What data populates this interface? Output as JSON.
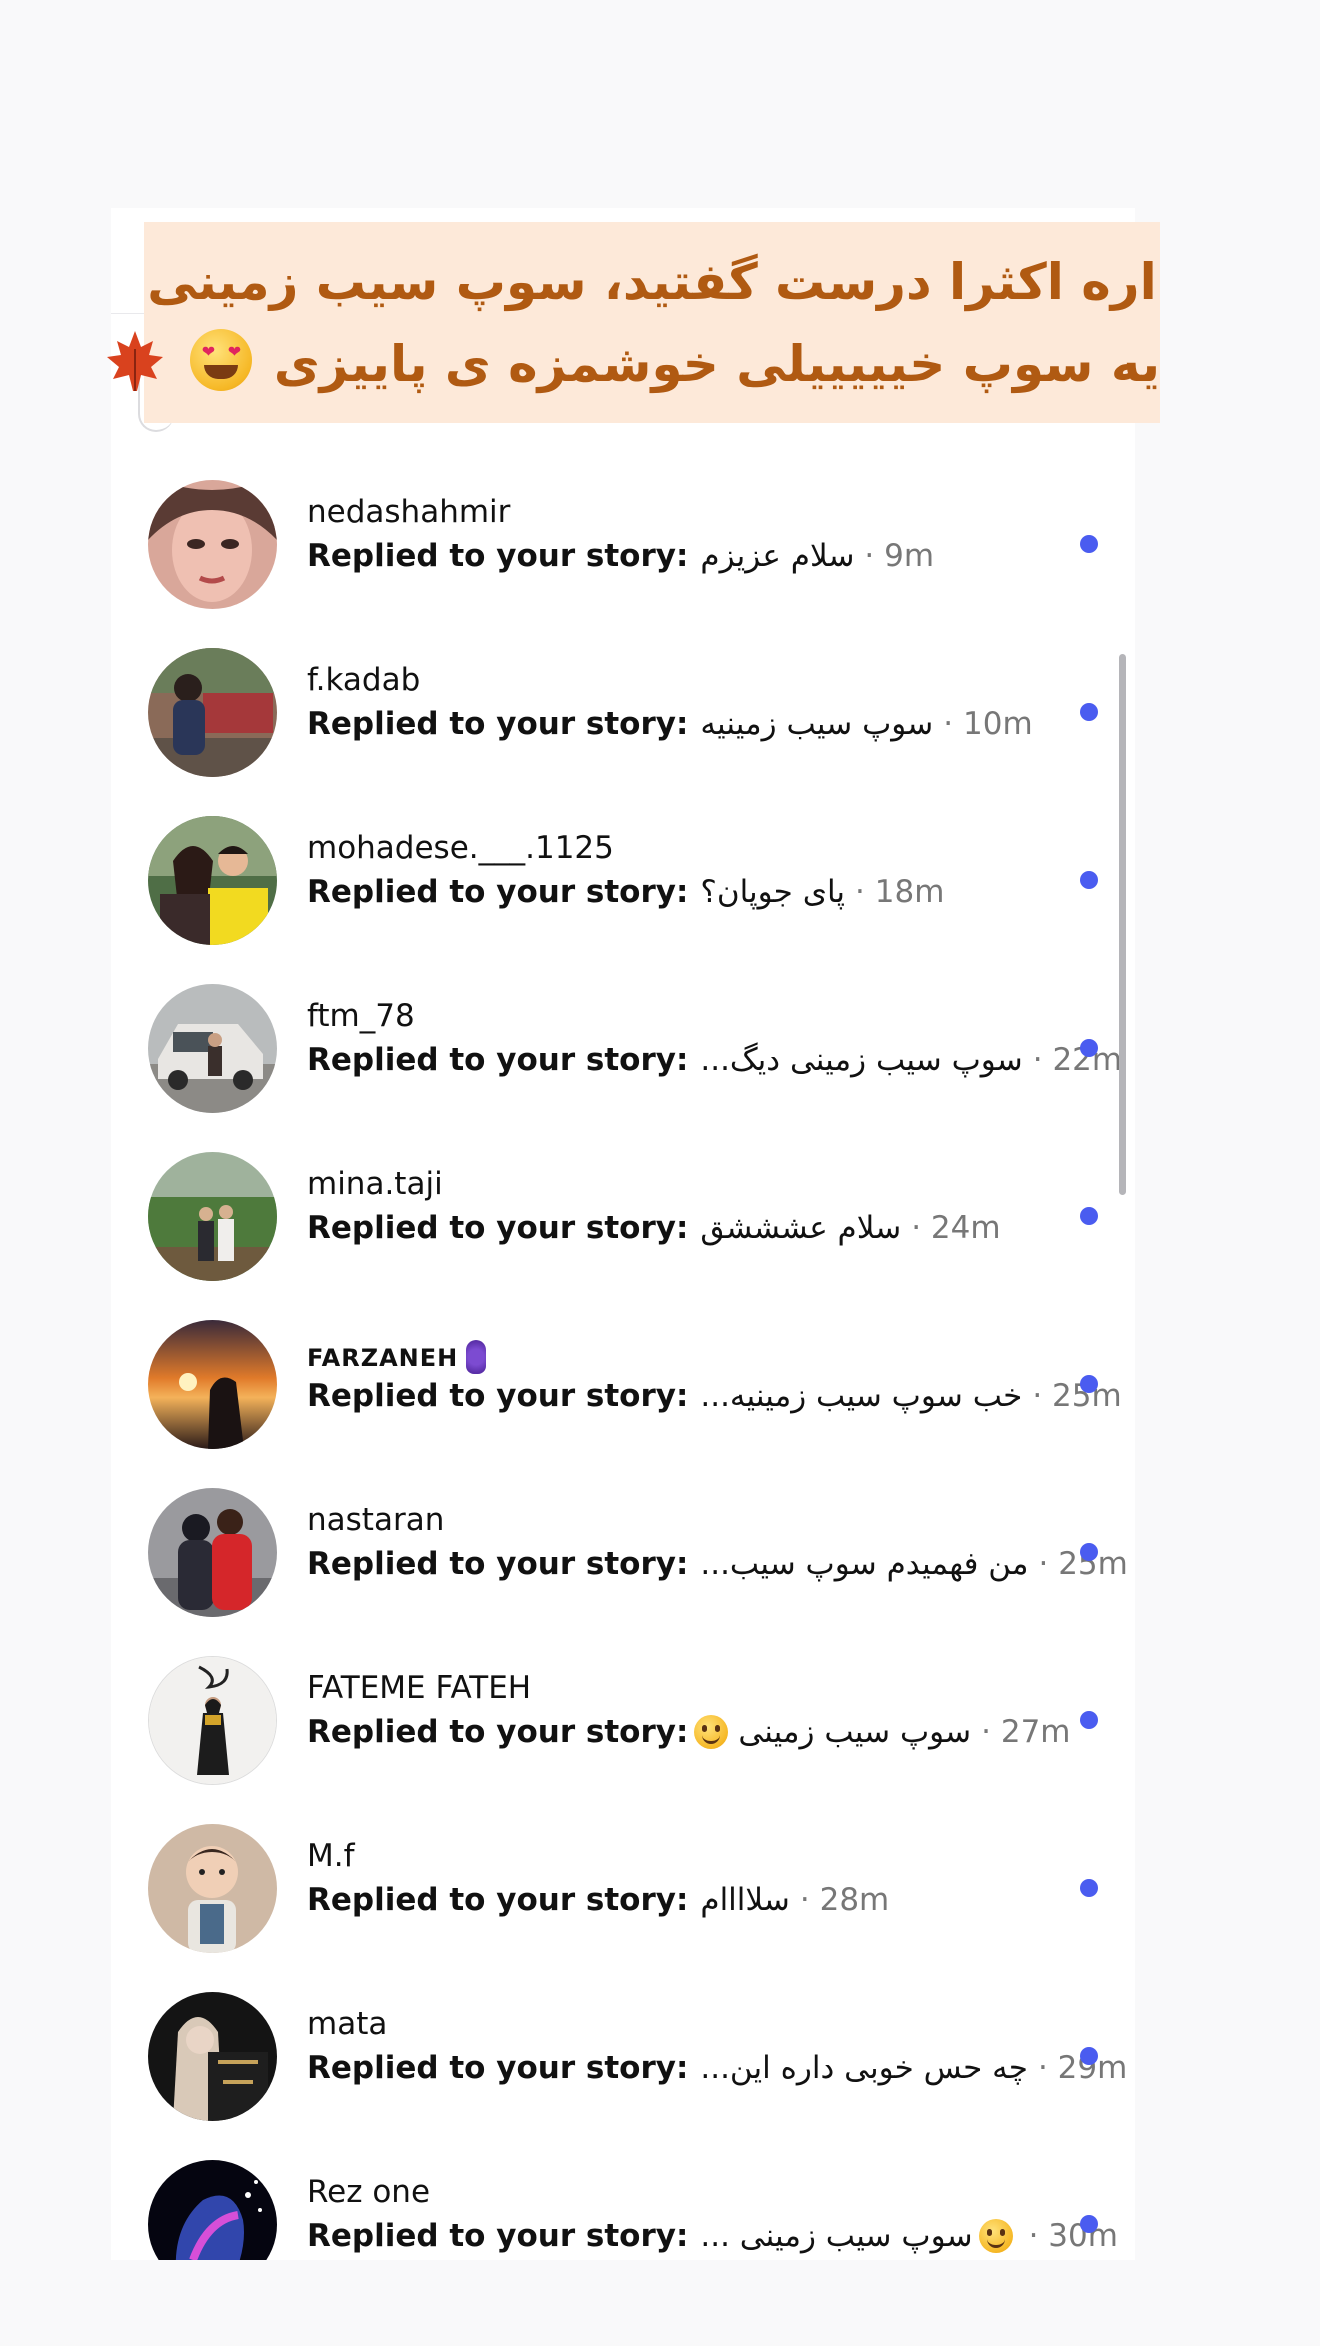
{
  "banner": {
    "line1": "اره اکثرا درست گفتید، سوپ سیب زمینی",
    "line2": "یه سوپ خیییییلی خوشمزه ی پاییزی",
    "emojis": [
      "heart-eyes-face-icon",
      "maple-leaf-icon"
    ]
  },
  "reply_prefix": "Replied to your story:",
  "colors": {
    "banner_bg": "#fde9d9",
    "banner_text": "#b05a12",
    "unread_dot": "#4a5cf0"
  },
  "messages": [
    {
      "username": "nedashahmir",
      "message": "سلام عزیزم",
      "time": "· 9m",
      "unread": true
    },
    {
      "username": "f.kadab",
      "message": "سوپ سیب زمینیه",
      "time": "· 10m",
      "unread": true
    },
    {
      "username": "mohadese.___.1125",
      "message": "پای جوپان؟",
      "time": "· 18m",
      "unread": true
    },
    {
      "username": "ftm_78",
      "message": "سوپ سیب زمینی دیگ...",
      "time": "· 22m",
      "unread": true
    },
    {
      "username": "mina.taji",
      "message": "سلام عشششق",
      "time": "· 24m",
      "unread": true
    },
    {
      "username": "FARZANEH",
      "message": "خب سوپ سیب زمینیه...",
      "time": "· 25m",
      "unread": true
    },
    {
      "username": "nastaran",
      "message": "من فهمیدم سوپ سیب...",
      "time": "· 25m",
      "unread": true
    },
    {
      "username": "FATEME FATEH",
      "message": "سوپ سیب زمینی",
      "time": "· 27m",
      "unread": true
    },
    {
      "username": "M.f",
      "message": "سلاااام",
      "time": "· 28m",
      "unread": true
    },
    {
      "username": "mata",
      "message": "چه حس خوبی داره این...",
      "time": "· 29m",
      "unread": true
    },
    {
      "username": "Rez one",
      "message": "سوپ سیب زمینی ...",
      "time": "· 30m",
      "unread": true
    }
  ]
}
